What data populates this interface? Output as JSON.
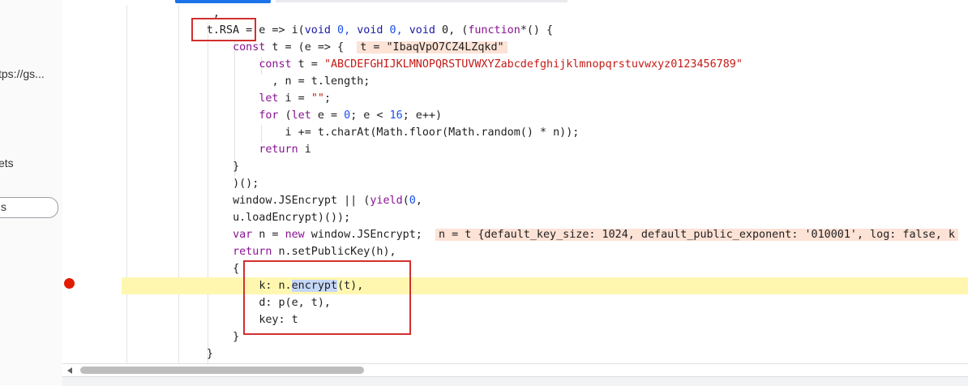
{
  "left_panel": {
    "items": [
      "tps://gs...",
      "ets",
      "s"
    ]
  },
  "colors": {
    "keyword": "#1a1aa6",
    "purple": "#881391",
    "string": "#c41a16",
    "number": "#1750eb",
    "default": "#1f1f1f",
    "inline_bg": "#fde2d6",
    "highlight_line": "#fff7b0",
    "selection": "#c6d8f7",
    "breakpoint": "#e01b00",
    "annotation_box": "#d32f2f"
  },
  "gutter_marker": "-",
  "code": {
    "l0": ",",
    "l1_a": "t.RSA",
    "l1_b": " = e => i(",
    "l1_c": "void",
    "l1_d": " 0, ",
    "l1_e": "void",
    "l1_f": " 0, ",
    "l1_g": "void",
    "l1_h": " 0, (",
    "l1_i": "function",
    "l1_j": "*() {",
    "l2_a": "const",
    "l2_b": " t = (e => {",
    "l2_inline": "t = \"IbaqVpO7CZ4LZqkd\"",
    "l3_a": "const",
    "l3_b": " t = ",
    "l3_c": "\"ABCDEFGHIJKLMNOPQRSTUVWXYZabcdefghijklmnopqrstuvwxyz0123456789\"",
    "l4": ", n = t.length;",
    "l5_a": "let",
    "l5_b": " i = ",
    "l5_c": "\"\"",
    "l5_d": ";",
    "l6_a": "for",
    "l6_b": " (",
    "l6_c": "let",
    "l6_d": " e = ",
    "l6_e": "0",
    "l6_f": "; e < ",
    "l6_g": "16",
    "l6_h": "; e++)",
    "l7": "i += t.charAt(Math.floor(Math.random() * n));",
    "l8_a": "return",
    "l8_b": " i",
    "l9": "}",
    "l10": ")();",
    "l11_a": "window.JSEncrypt || (",
    "l11_b": "yield",
    "l11_c": "(",
    "l11_d": "0",
    "l11_e": ",",
    "l12": "u.loadEncrypt)());",
    "l13_a": "var",
    "l13_b": " n = ",
    "l13_c": "new",
    "l13_d": " window.JSEncrypt;",
    "l13_inline": "n = t {default_key_size: 1024, default_public_exponent: '010001', log: false, k",
    "l14_a": "return",
    "l14_b": " n.setPublicKey(h),",
    "l15": "{",
    "l16_a": "k: n.",
    "l16_b": "encrypt",
    "l16_c": "(t),",
    "l17": "d: p(e, t),",
    "l18": "key: t",
    "l19": "}",
    "l20": "}"
  }
}
